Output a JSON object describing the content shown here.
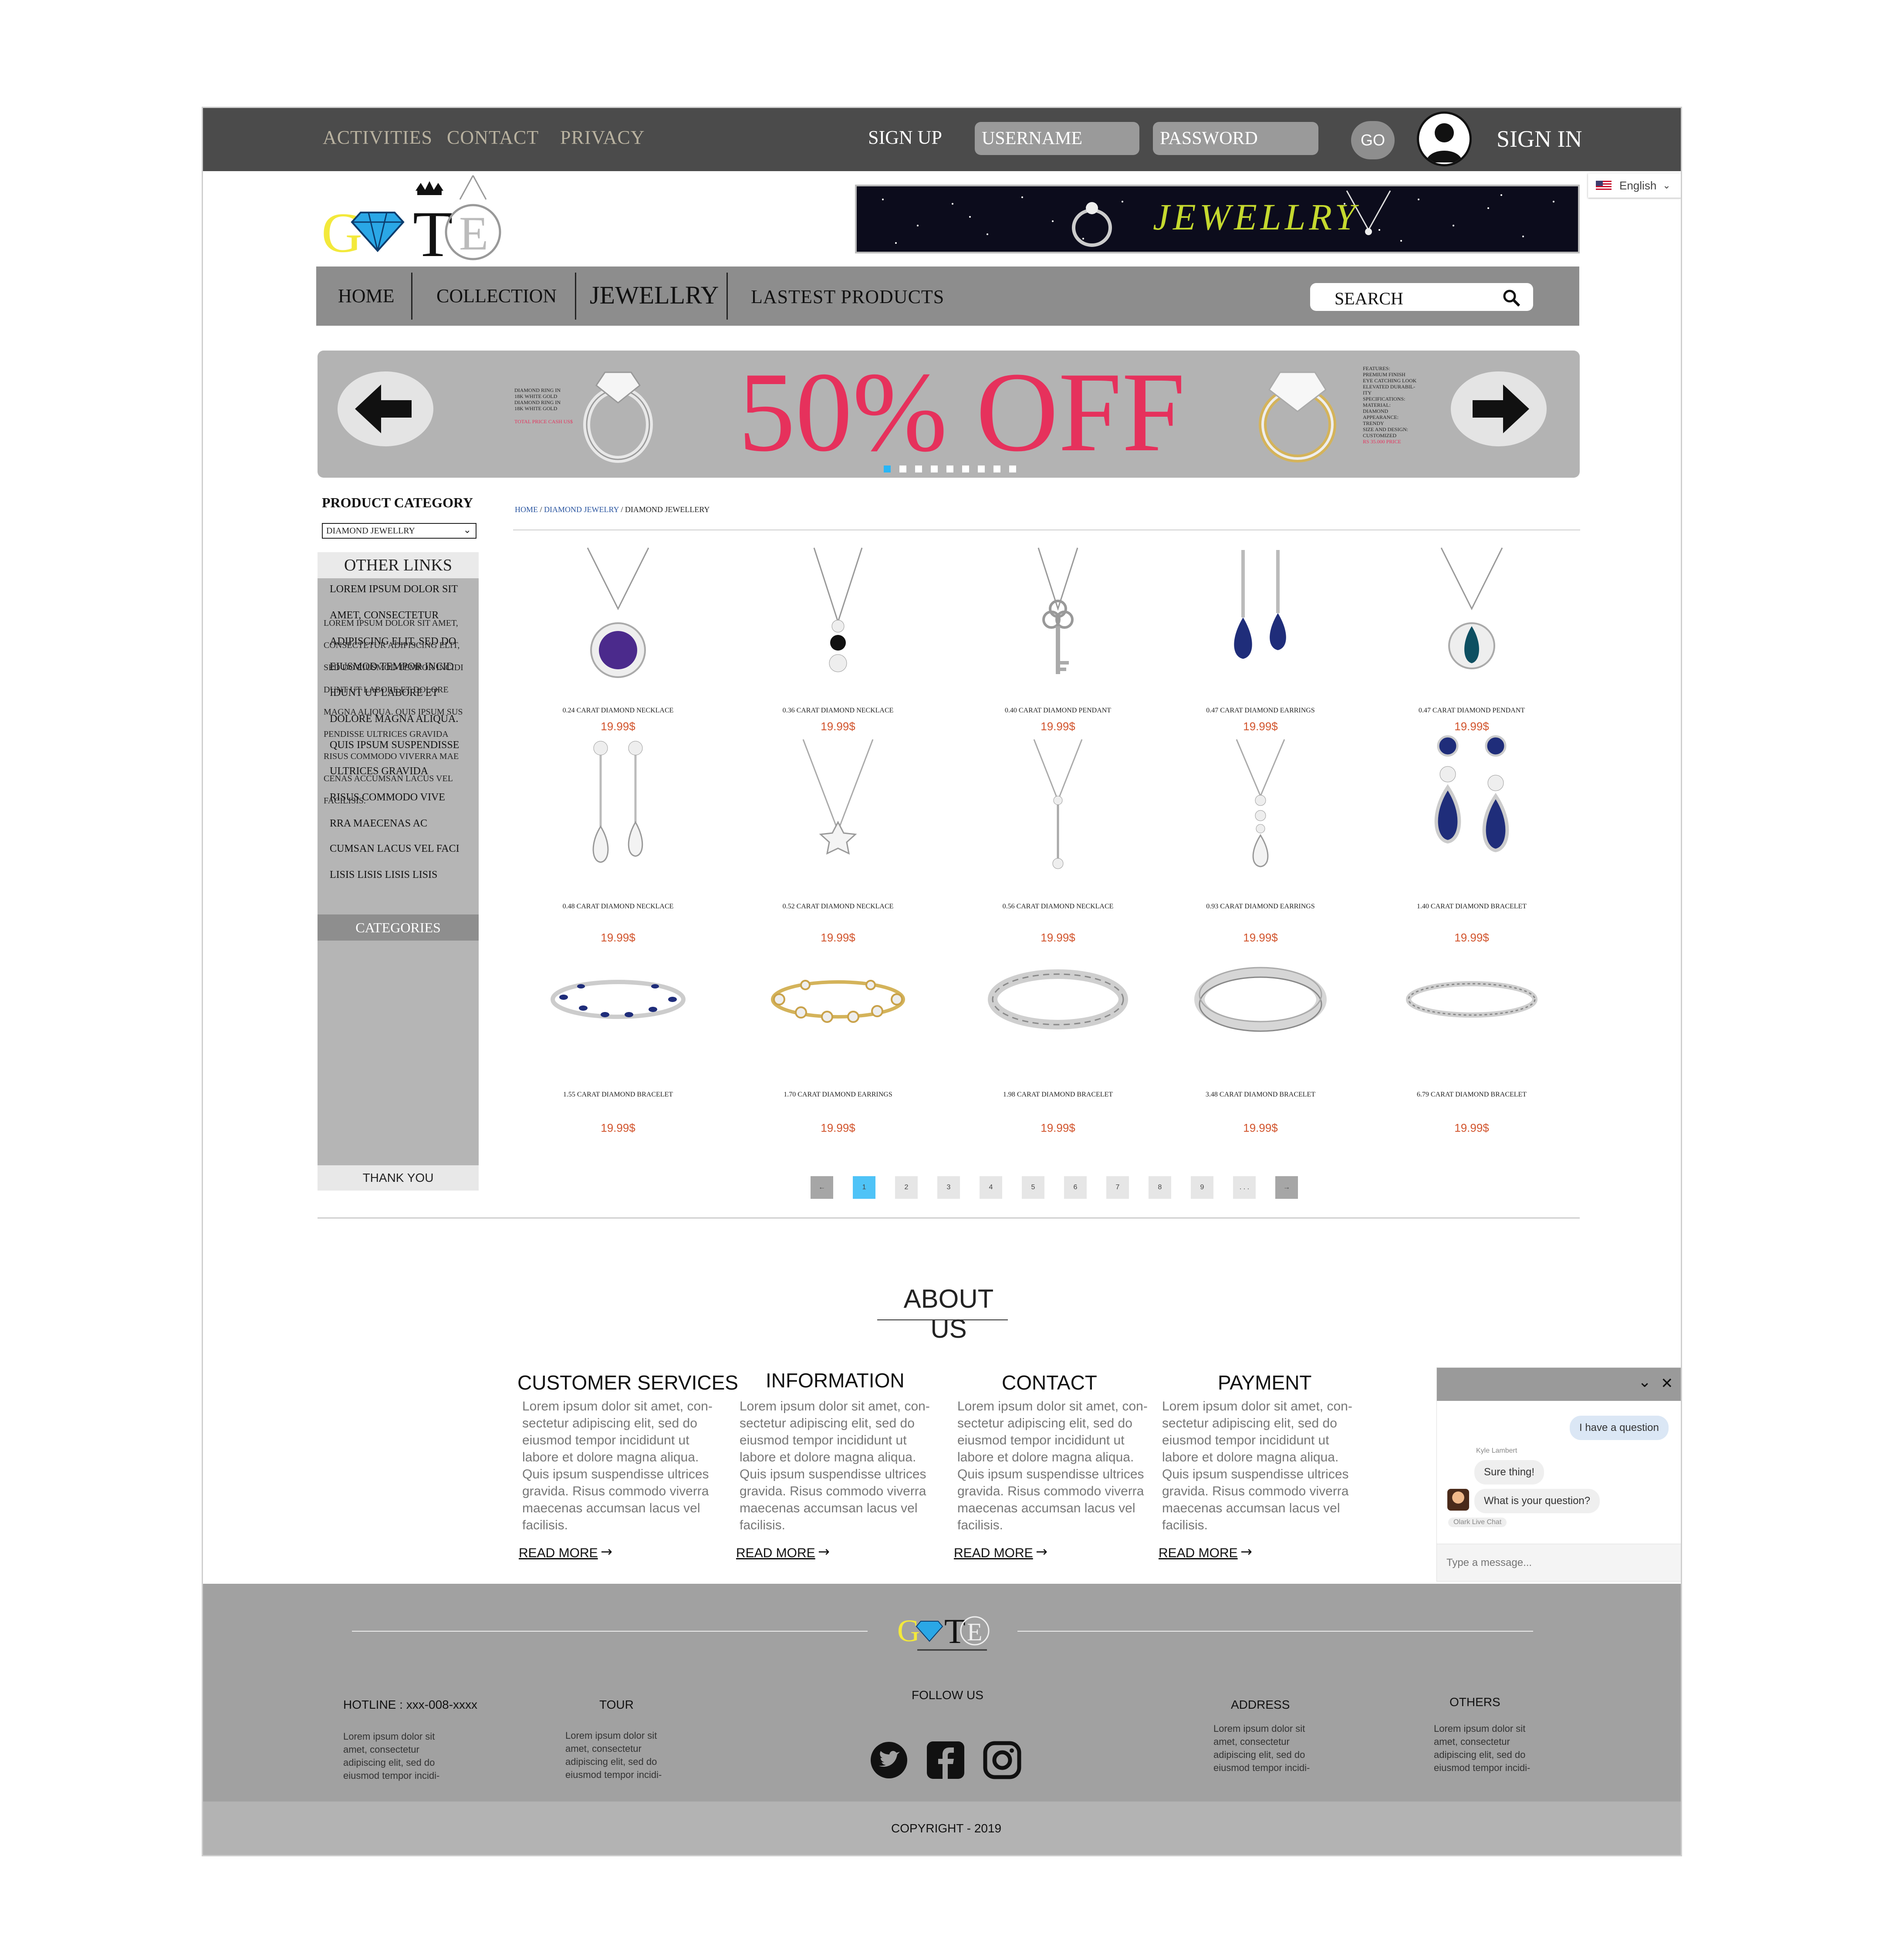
{
  "topbar": {
    "links": [
      "ACTIVITIES",
      "CONTACT",
      "PRIVACY"
    ],
    "sign_up": "SIGN UP",
    "username_placeholder": "USERNAME",
    "password_placeholder": "PASSWORD",
    "go": "GO",
    "sign_in": "SIGN IN"
  },
  "logo": {
    "letters": [
      "G",
      "T",
      "E"
    ]
  },
  "language": {
    "selected": "English"
  },
  "banner": {
    "text": "JEWELLRY"
  },
  "nav": {
    "items": [
      "HOME",
      "COLLECTION",
      "JEWELLRY",
      "LASTEST PRODUCTS"
    ],
    "search_placeholder": "SEARCH"
  },
  "slider": {
    "headline": "50% OFF",
    "left_caption": [
      "DIAMOND RING IN",
      "18K WHITE GOLD",
      "DIAMOND RING IN",
      "18K WHITE GOLD"
    ],
    "left_price": "TOTAL PRICE CASH US$",
    "right_caption": [
      "FEATURES:",
      "PREMIUM FINISH",
      "EYE CATCHING LOOK",
      "ELEVATED DURABIL-",
      "ITY",
      "SPECIFICATIONS:",
      "MATERIAL:",
      "DIAMOND",
      "APPEARANCE:",
      "TRENDY",
      "SIZE AND DESIGN:",
      "CUSTOMIZED"
    ],
    "right_price": "RS 35.000 PRICE",
    "active_slide": 1,
    "slide_count": 9
  },
  "sidebar": {
    "product_category_title": "PRODUCT CATEGORY",
    "product_category_value": "DIAMOND JEWELLRY",
    "other_links_title": "OTHER LINKS",
    "other_links": [
      "LOREM IPSUM DOLOR SIT",
      "AMET, CONSECTETUR",
      "ADIPISCING ELIT, SED DO",
      "EIUSMOD TEMPOR INCID",
      "IDUNT UT LABORE ET",
      "DOLORE MAGNA ALIQUA.",
      "QUIS IPSUM SUSPENDISSE",
      "ULTRICES GRAVIDA",
      "RISUS COMMODO VIVE",
      "RRA MAECENAS AC",
      "CUMSAN LACUS VEL FACI",
      "LISIS LISIS LISIS LISIS"
    ],
    "categories_title": "CATEGORIES",
    "categories_text": [
      "LOREM IPSUM DOLOR SIT AMET,",
      "CONSECTETUR ADIPISCING ELIT,",
      "SED DO EIUSMOD TEMPOR INCIDI",
      "DUNT UT LABORE ET DOLORE",
      "MAGNA ALIQUA. QUIS IPSUM SUS",
      "PENDISSE ULTRICES GRAVIDA",
      "RISUS COMMODO VIVERRA MAE",
      "CENAS ACCUMSAN LACUS VEL",
      "FACILISIS."
    ],
    "thank_you": "THANK YOU"
  },
  "breadcrumb": {
    "home": "HOME",
    "sep": " / ",
    "parent": "DIAMOND JEWELRY",
    "current": "DIAMOND JEWELLERY"
  },
  "products": [
    {
      "name": "0.24 CARAT DIAMOND NECKLACE",
      "price": "19.99$",
      "kind": "necklace-purple"
    },
    {
      "name": "0.36 CARAT DIAMOND NECKLACE",
      "price": "19.99$",
      "kind": "necklace-black"
    },
    {
      "name": "0.40 CARAT DIAMOND PENDANT",
      "price": "19.99$",
      "kind": "key-pendant"
    },
    {
      "name": "0.47 CARAT DIAMOND EARRINGS",
      "price": "19.99$",
      "kind": "earrings-blue"
    },
    {
      "name": "0.47 CARAT DIAMOND PENDANT",
      "price": "19.99$",
      "kind": "pendant-teal"
    },
    {
      "name": "0.48 CARAT DIAMOND NECKLACE",
      "price": "19.99$",
      "kind": "drop-earrings"
    },
    {
      "name": "0.52 CARAT DIAMOND NECKLACE",
      "price": "19.99$",
      "kind": "star-necklace"
    },
    {
      "name": "0.56 CARAT DIAMOND NECKLACE",
      "price": "19.99$",
      "kind": "lariat"
    },
    {
      "name": "0.93 CARAT DIAMOND EARRINGS",
      "price": "19.99$",
      "kind": "drop-pendant"
    },
    {
      "name": "1.40 CARAT DIAMOND BRACELET",
      "price": "19.99$",
      "kind": "earrings-sapphire"
    },
    {
      "name": "1.55 CARAT DIAMOND BRACELET",
      "price": "19.99$",
      "kind": "bracelet-blue"
    },
    {
      "name": "1.70 CARAT DIAMOND EARRINGS",
      "price": "19.99$",
      "kind": "bracelet-gold"
    },
    {
      "name": "1.98 CARAT DIAMOND BRACELET",
      "price": "19.99$",
      "kind": "bracelet-silver"
    },
    {
      "name": "3.48 CARAT DIAMOND BRACELET",
      "price": "19.99$",
      "kind": "bangle"
    },
    {
      "name": "6.79 CARAT DIAMOND BRACELET",
      "price": "19.99$",
      "kind": "tennis"
    }
  ],
  "pagination": {
    "prev": "←",
    "pages": [
      "1",
      "2",
      "3",
      "4",
      "5",
      "6",
      "7",
      "8",
      "9",
      ". . ."
    ],
    "next": "→",
    "current": "1"
  },
  "about": {
    "title": "ABOUT US",
    "columns": [
      {
        "title": "CUSTOMER SERVICES",
        "text": [
          "Lorem ipsum dolor sit amet, con-",
          "sectetur adipiscing elit, sed do",
          "eiusmod tempor incididunt ut",
          "labore et dolore magna aliqua.",
          "Quis ipsum suspendisse ultrices",
          "gravida. Risus commodo viverra",
          "maecenas accumsan lacus vel",
          "facilisis."
        ],
        "more": "READ MORE"
      },
      {
        "title": "INFORMATION",
        "text": [
          "Lorem ipsum dolor sit amet, con-",
          "sectetur adipiscing elit, sed do",
          "eiusmod tempor incididunt ut",
          "labore et dolore magna aliqua.",
          "Quis ipsum suspendisse ultrices",
          "gravida. Risus commodo viverra",
          "maecenas accumsan lacus vel",
          "facilisis."
        ],
        "more": "READ MORE"
      },
      {
        "title": "CONTACT",
        "text": [
          "Lorem ipsum dolor sit amet, con-",
          "sectetur adipiscing elit, sed do",
          "eiusmod tempor incididunt ut",
          "labore et dolore magna aliqua.",
          "Quis ipsum suspendisse ultrices",
          "gravida. Risus commodo viverra",
          "maecenas accumsan lacus vel",
          "facilisis."
        ],
        "more": "READ MORE"
      },
      {
        "title": "PAYMENT",
        "text": [
          "Lorem ipsum dolor sit amet, con-",
          "sectetur adipiscing elit, sed do",
          "eiusmod tempor incididunt ut",
          "labore et dolore magna aliqua.",
          "Quis ipsum suspendisse ultrices",
          "gravida. Risus commodo viverra",
          "maecenas accumsan lacus vel",
          "facilisis."
        ],
        "more": "READ MORE"
      }
    ]
  },
  "chat": {
    "user_message": "I have a question",
    "agent_name": "Kyle Lambert",
    "agent_messages": [
      "Sure thing!",
      "What is your question?"
    ],
    "brand_tag": "Olark Live Chat",
    "input_placeholder": "Type a message..."
  },
  "footer": {
    "hotline": "HOTLINE : xxx-008-xxxx",
    "tour": "TOUR",
    "follow": "FOLLOW US",
    "address": "ADDRESS",
    "others": "OTHERS",
    "blurb": [
      "Lorem ipsum dolor sit",
      "amet, consectetur",
      "adipiscing elit, sed do",
      "eiusmod tempor incidi-"
    ],
    "copyright": "COPYRIGHT - 2019"
  },
  "colors": {
    "topbar": "#4b4b4b",
    "nav": "#8d8d8d",
    "accent": "#e6315c",
    "price": "#d2552e",
    "page_active": "#4fc3f7",
    "footer": "#a1a1a1"
  }
}
